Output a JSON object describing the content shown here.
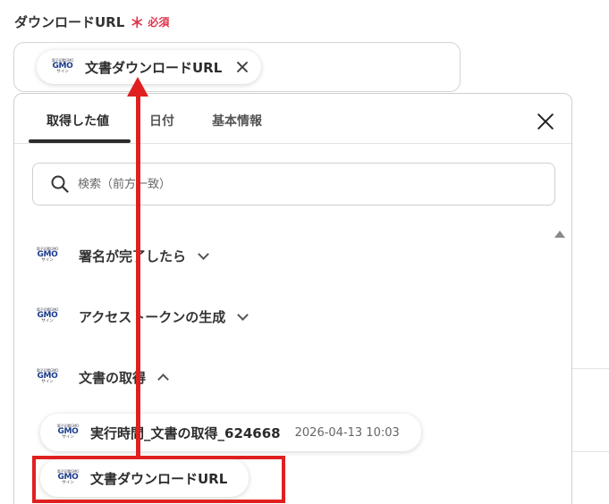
{
  "field": {
    "label": "ダウンロードURL",
    "required_mark": "＊",
    "required_text": "必須",
    "selected_chip": {
      "label": "文書ダウンロードURL",
      "icon": "gmo-sign-logo"
    }
  },
  "logo": {
    "line1": "電子印鑑GMO",
    "line2": "GMO",
    "line3": "サイン"
  },
  "dropdown": {
    "tabs": [
      {
        "label": "取得した値",
        "active": true
      },
      {
        "label": "日付",
        "active": false
      },
      {
        "label": "基本情報",
        "active": false
      }
    ],
    "search": {
      "placeholder": "検索（前方一致）",
      "value": ""
    },
    "groups": [
      {
        "label": "署名が完了したら",
        "expanded": false
      },
      {
        "label": "アクセストークンの生成",
        "expanded": false
      },
      {
        "label": "文書の取得",
        "expanded": true
      }
    ],
    "values": [
      {
        "label": "実行時間_文書の取得_624668",
        "date": "2026-04-13 10:03"
      },
      {
        "label": "文書ダウンロードURL",
        "date": ""
      }
    ]
  },
  "colors": {
    "accent_red": "#e02020",
    "required": "#e0334d",
    "brand_blue": "#1b3c8c"
  }
}
